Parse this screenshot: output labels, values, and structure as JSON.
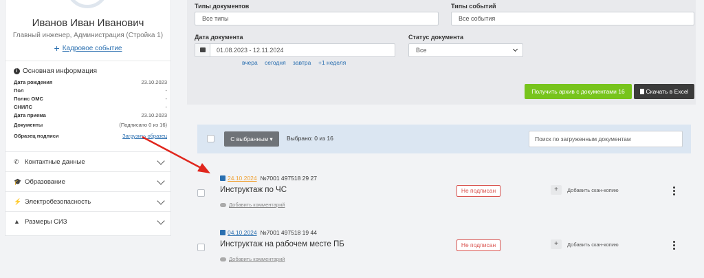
{
  "employee": {
    "name": "Иванов Иван Иванович",
    "position": "Главный инженер, Администрация (Стройка 1)",
    "hr_event_link": "Кадровое событие",
    "plus_glyph": "+"
  },
  "basic_info": {
    "title": "Основная информация",
    "icon_glyph": "i",
    "rows": [
      {
        "key": "Дата рождения",
        "value": "23.10.2023"
      },
      {
        "key": "Пол",
        "value": "-"
      },
      {
        "key": "Полис ОМС",
        "value": "-"
      },
      {
        "key": "СНИЛС",
        "value": "-"
      },
      {
        "key": "Дата приема",
        "value": "23.10.2023"
      },
      {
        "key": "Документы",
        "value": "(Подписано 0 из 16)"
      },
      {
        "key": "Образец подписи",
        "value": "Загрузить образец"
      }
    ]
  },
  "accordion": [
    {
      "icon": "phone-icon",
      "glyph": "✆",
      "label": "Контактные данные"
    },
    {
      "icon": "graduation-cap-icon",
      "glyph": "🎓",
      "label": "Образование"
    },
    {
      "icon": "lightning-icon",
      "glyph": "⚡",
      "label": "Электробезопасность"
    },
    {
      "icon": "ppe-icon",
      "glyph": "▲",
      "label": "Размеры СИЗ"
    }
  ],
  "filters": {
    "doc_types_label": "Типы документов",
    "doc_types_placeholder": "Все типы",
    "event_types_label": "Типы событий",
    "event_types_placeholder": "Все события",
    "date_label": "Дата документа",
    "date_value": "01.08.2023 - 12.11.2024",
    "quick_links": [
      "вчера",
      "сегодня",
      "завтра",
      "+1 неделя"
    ],
    "status_label": "Статус документа",
    "status_value": "Все",
    "archive_button": "Получить архив с документами 16",
    "excel_button": "Скачать в Excel"
  },
  "toolbar": {
    "bulk_button": "С выбранным ▾",
    "selected_count": "Выбрано: 0 из 16",
    "search_placeholder": "Поиск по загруженным документам"
  },
  "documents": [
    {
      "date": "24.10.2024",
      "date_color": "#f0a030",
      "number": "№7001 497518 29 27",
      "title": "Инструктаж по ЧС",
      "status": "Не подписан",
      "add_scan": "Добавить скан-копию",
      "comment": "Добавить комментарий",
      "plus_glyph": "+"
    },
    {
      "date": "04.10.2024",
      "date_color": "#2a6fb0",
      "number": "№7001 497518 19 44",
      "title": "Инструктаж на рабочем месте ПБ",
      "status": "Не подписан",
      "add_scan": "Добавить скан-копию",
      "comment": "Добавить комментарий",
      "plus_glyph": "+"
    }
  ],
  "colors": {
    "accent": "#2a6fb0",
    "success": "#77c41c",
    "danger": "#d9534f",
    "annotation_arrow": "#e0261d"
  }
}
